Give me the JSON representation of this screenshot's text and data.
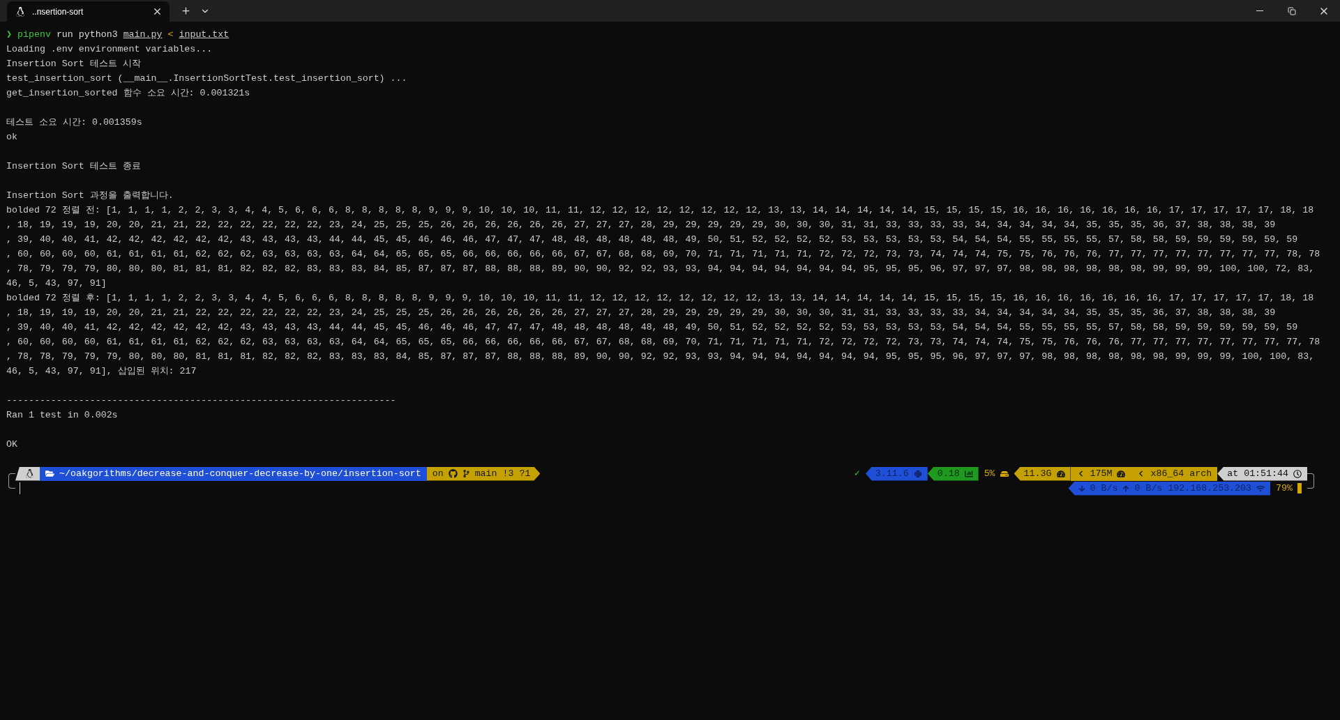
{
  "tabs": [
    {
      "title": "..nsertion-sort",
      "selected": true
    }
  ],
  "command": {
    "prompt_symbol": "❯",
    "program": "pipenv",
    "args": "run python3",
    "script": "main.py",
    "redirect": "<",
    "input": "input.txt"
  },
  "output_blocks": [
    [
      "Loading .env environment variables...",
      "Insertion Sort 테스트 시작",
      "test_insertion_sort (__main__.InsertionSortTest.test_insertion_sort) ...",
      "get_insertion_sorted 함수 소요 시간: 0.001321s"
    ],
    [
      "테스트 소요 시간: 0.001359s",
      "ok"
    ],
    [
      "Insertion Sort 테스트 종료"
    ],
    [
      "Insertion Sort 과정을 출력합니다.",
      "bolded 72 정렬 전: [1, 1, 1, 1, 2, 2, 3, 3, 4, 4, 5, 6, 6, 6, 8, 8, 8, 8, 8, 9, 9, 9, 10, 10, 10, 11, 11, 12, 12, 12, 12, 12, 12, 12, 12, 13, 13, 14, 14, 14, 14, 14, 15, 15, 15, 15, 16, 16, 16, 16, 16, 16, 16, 17, 17, 17, 17, 17, 18, 18",
      ", 18, 19, 19, 19, 20, 20, 21, 21, 22, 22, 22, 22, 22, 22, 23, 24, 25, 25, 25, 26, 26, 26, 26, 26, 26, 27, 27, 27, 28, 29, 29, 29, 29, 29, 30, 30, 30, 31, 31, 33, 33, 33, 33, 34, 34, 34, 34, 34, 35, 35, 35, 36, 37, 38, 38, 38, 39",
      ", 39, 40, 40, 41, 42, 42, 42, 42, 42, 42, 43, 43, 43, 43, 44, 44, 45, 45, 46, 46, 46, 47, 47, 47, 48, 48, 48, 48, 48, 48, 49, 50, 51, 52, 52, 52, 52, 53, 53, 53, 53, 53, 54, 54, 54, 55, 55, 55, 55, 57, 58, 58, 59, 59, 59, 59, 59, 59",
      ", 60, 60, 60, 60, 61, 61, 61, 61, 62, 62, 62, 63, 63, 63, 63, 64, 64, 65, 65, 65, 66, 66, 66, 66, 66, 67, 67, 68, 68, 69, 70, 71, 71, 71, 71, 71, 72, 72, 72, 73, 73, 74, 74, 74, 75, 75, 76, 76, 76, 77, 77, 77, 77, 77, 77, 77, 77, 78, 78",
      ", 78, 79, 79, 79, 80, 80, 80, 81, 81, 81, 82, 82, 82, 83, 83, 83, 84, 85, 87, 87, 87, 88, 88, 88, 89, 90, 90, 92, 92, 93, 93, 94, 94, 94, 94, 94, 94, 94, 95, 95, 95, 96, 97, 97, 97, 98, 98, 98, 98, 98, 98, 99, 99, 99, 100, 100, 72, 83,",
      "46, 5, 43, 97, 91]",
      "bolded 72 정렬 후: [1, 1, 1, 1, 2, 2, 3, 3, 4, 4, 5, 6, 6, 6, 8, 8, 8, 8, 8, 9, 9, 9, 10, 10, 10, 11, 11, 12, 12, 12, 12, 12, 12, 12, 12, 13, 13, 14, 14, 14, 14, 14, 15, 15, 15, 15, 16, 16, 16, 16, 16, 16, 16, 17, 17, 17, 17, 17, 18, 18",
      ", 18, 19, 19, 19, 20, 20, 21, 21, 22, 22, 22, 22, 22, 22, 23, 24, 25, 25, 25, 26, 26, 26, 26, 26, 26, 27, 27, 27, 28, 29, 29, 29, 29, 29, 30, 30, 30, 31, 31, 33, 33, 33, 33, 34, 34, 34, 34, 34, 35, 35, 35, 36, 37, 38, 38, 38, 39",
      ", 39, 40, 40, 41, 42, 42, 42, 42, 42, 42, 43, 43, 43, 43, 44, 44, 45, 45, 46, 46, 46, 47, 47, 47, 48, 48, 48, 48, 48, 48, 49, 50, 51, 52, 52, 52, 52, 53, 53, 53, 53, 53, 54, 54, 54, 55, 55, 55, 55, 57, 58, 58, 59, 59, 59, 59, 59, 59",
      ", 60, 60, 60, 60, 61, 61, 61, 61, 62, 62, 62, 63, 63, 63, 63, 64, 64, 65, 65, 65, 66, 66, 66, 66, 66, 67, 67, 68, 68, 69, 70, 71, 71, 71, 71, 71, 72, 72, 72, 72, 73, 73, 74, 74, 74, 75, 75, 76, 76, 76, 77, 77, 77, 77, 77, 77, 77, 77, 78",
      ", 78, 78, 79, 79, 79, 80, 80, 80, 81, 81, 81, 82, 82, 82, 83, 83, 83, 84, 85, 87, 87, 87, 88, 88, 88, 89, 90, 90, 92, 92, 93, 93, 94, 94, 94, 94, 94, 94, 94, 95, 95, 95, 96, 97, 97, 97, 98, 98, 98, 98, 98, 98, 99, 99, 99, 100, 100, 83,",
      "46, 5, 43, 97, 91], 삽입된 위치: 217"
    ],
    [
      "----------------------------------------------------------------------",
      "Ran 1 test in 0.002s"
    ],
    [
      "OK"
    ]
  ],
  "prompt": {
    "left": [
      {
        "kind": "os"
      },
      {
        "kind": "path",
        "text": "~/oakgorithms/decrease-and-conquer-decrease-by-one/insertion-sort"
      },
      {
        "kind": "git",
        "prefix": "on",
        "text": "main !3 ?1"
      }
    ],
    "status_symbol": "✓",
    "right": [
      {
        "kind": "python",
        "text": "3.11.6"
      },
      {
        "kind": "load",
        "text": "0.18"
      },
      {
        "kind": "disk",
        "text": "5%"
      },
      {
        "kind": "memory",
        "text": "11.3G"
      },
      {
        "kind": "swap",
        "text": "175M"
      },
      {
        "kind": "arch",
        "text": "x86_64 arch"
      },
      {
        "kind": "time",
        "text": "at 01:51:44"
      }
    ],
    "network": {
      "download": "0 B/s",
      "upload": "0 B/s",
      "ip": "192.168.253.203"
    },
    "battery": {
      "text": "79%"
    }
  }
}
